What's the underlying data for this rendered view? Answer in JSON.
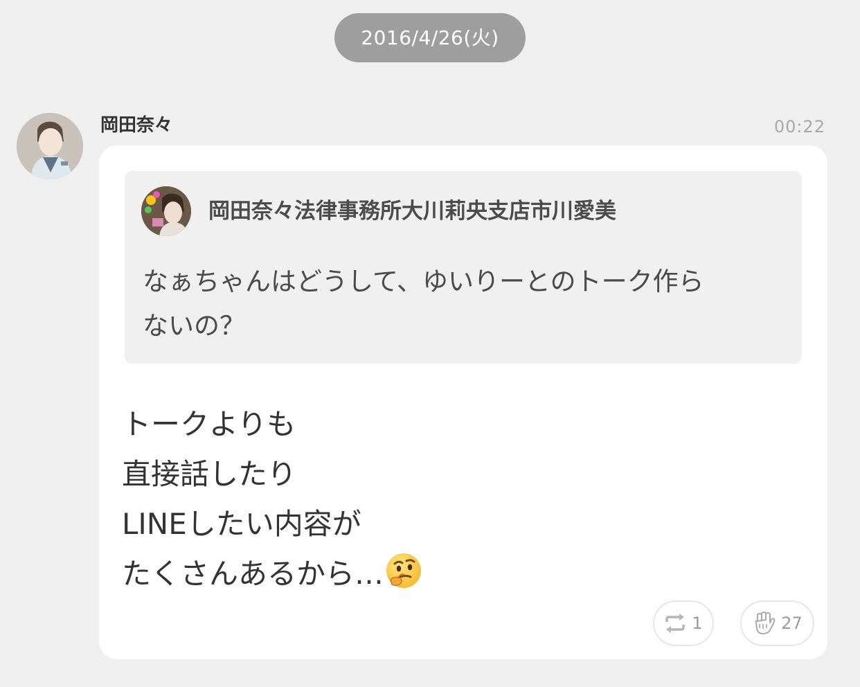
{
  "date_divider": "2016/4/26(火)",
  "post": {
    "sender_name": "岡田奈々",
    "time": "00:22",
    "quote": {
      "author": "岡田奈々法律事務所大川莉央支店市川愛美",
      "lines": [
        "なぁちゃんはどうして、ゆいりーとのトーク作ら",
        "ないの？"
      ]
    },
    "message_lines": [
      "トークよりも",
      "直接話したり",
      "LINEしたい内容が",
      "たくさんあるから…"
    ],
    "emoji": "thinking-face",
    "actions": {
      "repost_icon": "repost-icon",
      "repost_count": "1",
      "like_icon": "hand-clap-icon",
      "like_count": "27"
    }
  },
  "colors": {
    "background": "#efefef",
    "date_pill": "#9e9e9e",
    "bubble": "#ffffff",
    "quote_bg": "#f0f0f0",
    "muted_text": "#a8a8a8"
  }
}
